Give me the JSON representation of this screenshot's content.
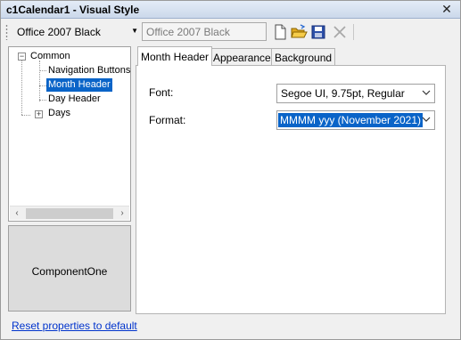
{
  "window": {
    "title": "c1Calendar1 - Visual Style",
    "close_glyph": "✕"
  },
  "toolbar": {
    "theme_select_value": "Office 2007 Black",
    "theme_name_value": "Office 2007 Black",
    "icons": [
      "new-icon",
      "open-folder-icon",
      "save-icon",
      "delete-icon"
    ]
  },
  "tree": {
    "items": [
      {
        "label": "Common",
        "expander": "−"
      },
      {
        "label": "Navigation Buttons"
      },
      {
        "label": "Month Header",
        "selected": true
      },
      {
        "label": "Day Header"
      },
      {
        "label": "Days",
        "expander": "+"
      }
    ],
    "scroll_left": "‹",
    "scroll_right": "›"
  },
  "brand": {
    "text": "ComponentOne"
  },
  "reset_link": "Reset properties to default",
  "tabs": [
    {
      "label": "Month Header",
      "active": true
    },
    {
      "label": "Appearance"
    },
    {
      "label": "Background"
    }
  ],
  "month_header": {
    "font_label": "Font:",
    "font_value": "Segoe UI, 9.75pt, Regular",
    "format_label": "Format:",
    "format_value": "MMMM yyy (November 2021)"
  },
  "colors": {
    "selection": "#0a64c8",
    "link": "#0033cc",
    "title_gradient_top": "#e4ecf7",
    "title_gradient_bottom": "#cbd8ea"
  }
}
